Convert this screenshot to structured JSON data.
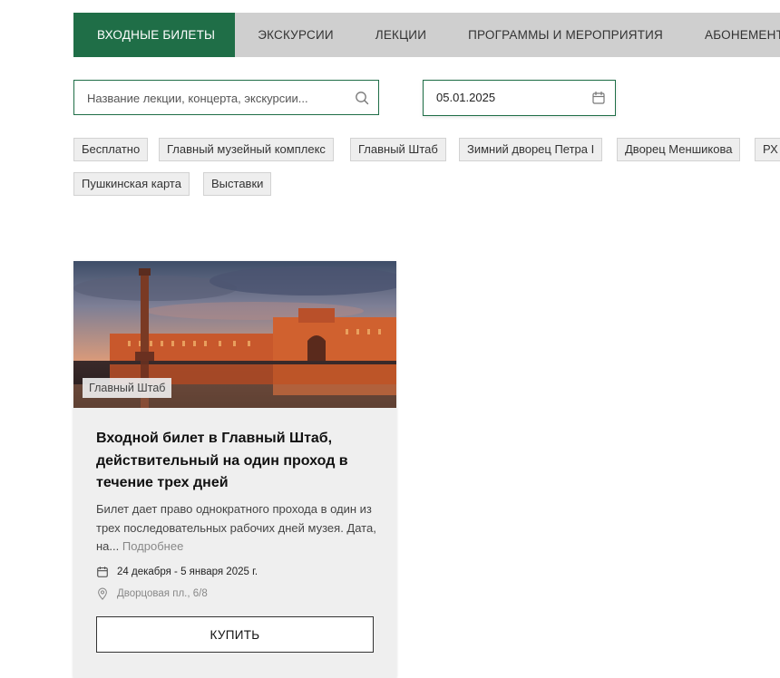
{
  "tabs": [
    {
      "label": "ВХОДНЫЕ БИЛЕТЫ",
      "active": true
    },
    {
      "label": "ЭКСКУРСИИ",
      "active": false
    },
    {
      "label": "ЛЕКЦИИ",
      "active": false
    },
    {
      "label": "ПРОГРАММЫ И МЕРОПРИЯТИЯ",
      "active": false
    },
    {
      "label": "АБОНЕМЕНТЫ",
      "active": false
    }
  ],
  "search": {
    "placeholder": "Название лекции, концерта, экскурсии...",
    "value": "",
    "icon": "search-icon"
  },
  "date_filter": {
    "value": "05.01.2025",
    "icon": "calendar-icon"
  },
  "filters": [
    "Бесплатно",
    "Главный музейный комплекс",
    "Главный Штаб",
    "Зимний дворец Петра I",
    "Дворец Меншикова",
    "РХ",
    "Пушкинская карта",
    "Выставки"
  ],
  "card": {
    "tag": "Главный Штаб",
    "title": "Входной билет в Главный Штаб, действительный на один проход в течение трех дней",
    "description": "Билет дает право однократного прохода в один из трех последовательных рабочих дней музея. Дата, на...",
    "more_link": "Подробнее",
    "dates": "24 декабря - 5 января 2025 г.",
    "address": "Дворцовая пл., 6/8",
    "buy_label": "КУПИТЬ"
  },
  "colors": {
    "accent": "#1f6e47",
    "tab_bar": "#cfcfcf",
    "chip_bg": "#eeeeee",
    "card_bg": "#efefef"
  }
}
